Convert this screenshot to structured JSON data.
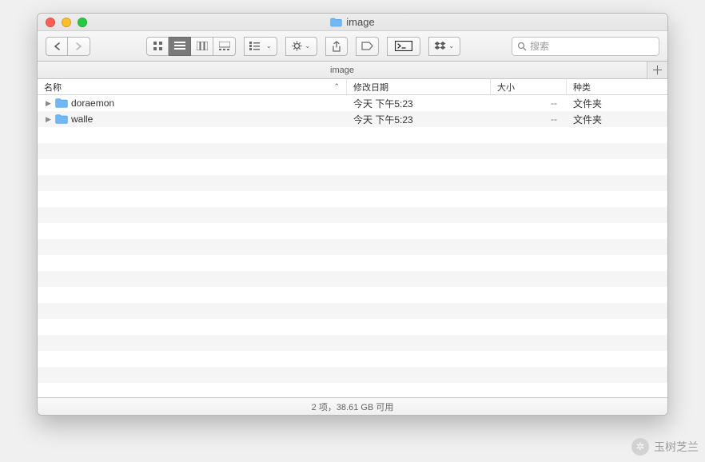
{
  "window": {
    "title": "image",
    "path_bar": "image"
  },
  "toolbar": {
    "search_placeholder": "搜索"
  },
  "columns": {
    "name": "名称",
    "date": "修改日期",
    "size": "大小",
    "kind": "种类"
  },
  "rows": [
    {
      "name": "doraemon",
      "date": "今天 下午5:23",
      "size": "--",
      "kind": "文件夹"
    },
    {
      "name": "walle",
      "date": "今天 下午5:23",
      "size": "--",
      "kind": "文件夹"
    }
  ],
  "status": "2 项，38.61 GB 可用",
  "watermark": "玉树芝兰"
}
